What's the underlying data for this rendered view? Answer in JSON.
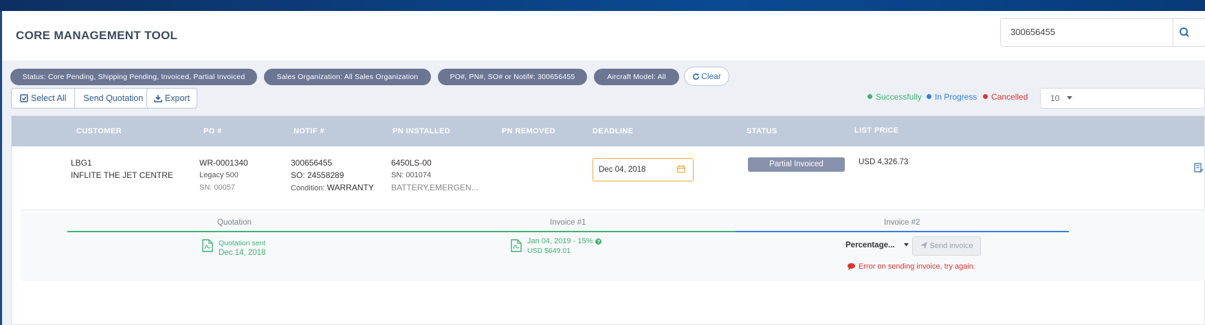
{
  "header": {
    "title": "CORE MANAGEMENT TOOL",
    "search_value": "300656455"
  },
  "filters": {
    "chips": [
      {
        "label": "Status: Core Pending, Shipping Pending, Invoiced, Partial Invoiced"
      },
      {
        "label": "Sales Organization: All Sales Organization"
      },
      {
        "label": "PO#, PN#, SO# or Notif#: 300656455"
      },
      {
        "label": "Aircraft Model: All"
      }
    ],
    "clear_label": "Clear"
  },
  "toolbar": {
    "select_all_label": "Select All",
    "send_quotation_label": "Send Quotation",
    "export_label": "Export",
    "page_size": "10"
  },
  "legend": {
    "items": [
      {
        "label": "Successfully",
        "color": "#3cb371"
      },
      {
        "label": "In Progress",
        "color": "#2f7fe0"
      },
      {
        "label": "Cancelled",
        "color": "#e03131"
      }
    ]
  },
  "table": {
    "columns": [
      "CUSTOMER",
      "PO #",
      "NOTIF #",
      "PN INSTALLED",
      "PN REMOVED",
      "DEADLINE",
      "STATUS",
      "LIST PRICE"
    ],
    "row": {
      "customer_code": "LBG1",
      "customer_name": "INFLITE THE JET CENTRE",
      "po": "WR-0001340",
      "aircraft": "Legacy 500",
      "sn": "SN: 00057",
      "notif": "300656455",
      "so": "SO: 24558289",
      "condition_label": "Condition:",
      "condition_value": "WARRANTY",
      "pn_installed": "6450LS-00",
      "pn_sn": "SN: 001074",
      "pn_desc": "BATTERY,EMERGEN...",
      "deadline": "Dec 04, 2018",
      "status": "Partial Invoiced",
      "list_price": "USD 4,326.73"
    }
  },
  "steps": {
    "items": [
      {
        "label": "Quotation"
      },
      {
        "label": "Invoice #1"
      },
      {
        "label": "Invoice #2"
      }
    ],
    "quotation": {
      "line1": "Quotation sent",
      "line2": "Dec 14, 2018"
    },
    "invoice1": {
      "line1": "Jan 04, 2019 - 15%",
      "line2": "USD $649.01"
    },
    "invoice2": {
      "select_value": "Percentage...",
      "send_label": "Send invoice",
      "error": "Error on sending invoice, try again."
    }
  }
}
